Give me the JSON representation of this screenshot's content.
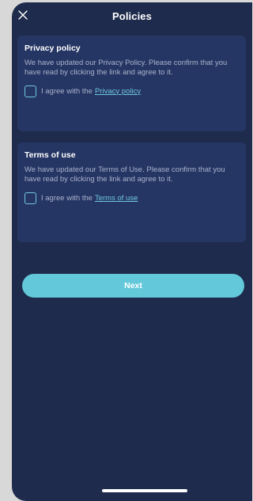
{
  "header": {
    "title": "Policies",
    "close_icon": "close-icon"
  },
  "privacy": {
    "title": "Privacy policy",
    "body": "We have updated our Privacy Policy. Please confirm that you have read by clicking the link and agree to it.",
    "agree_prefix": "I agree with the",
    "link_text": "Privacy policy",
    "checked": false
  },
  "terms": {
    "title": "Terms of use",
    "body": "We have updated our Terms of Use. Please confirm that you have read by clicking the link and agree to it.",
    "agree_prefix": "I agree with the",
    "link_text": "Terms of use",
    "checked": false
  },
  "actions": {
    "next_label": "Next"
  },
  "colors": {
    "background": "#1e2b4c",
    "card": "#263664",
    "accent": "#63c9da",
    "muted_text": "#a9b2cb"
  }
}
